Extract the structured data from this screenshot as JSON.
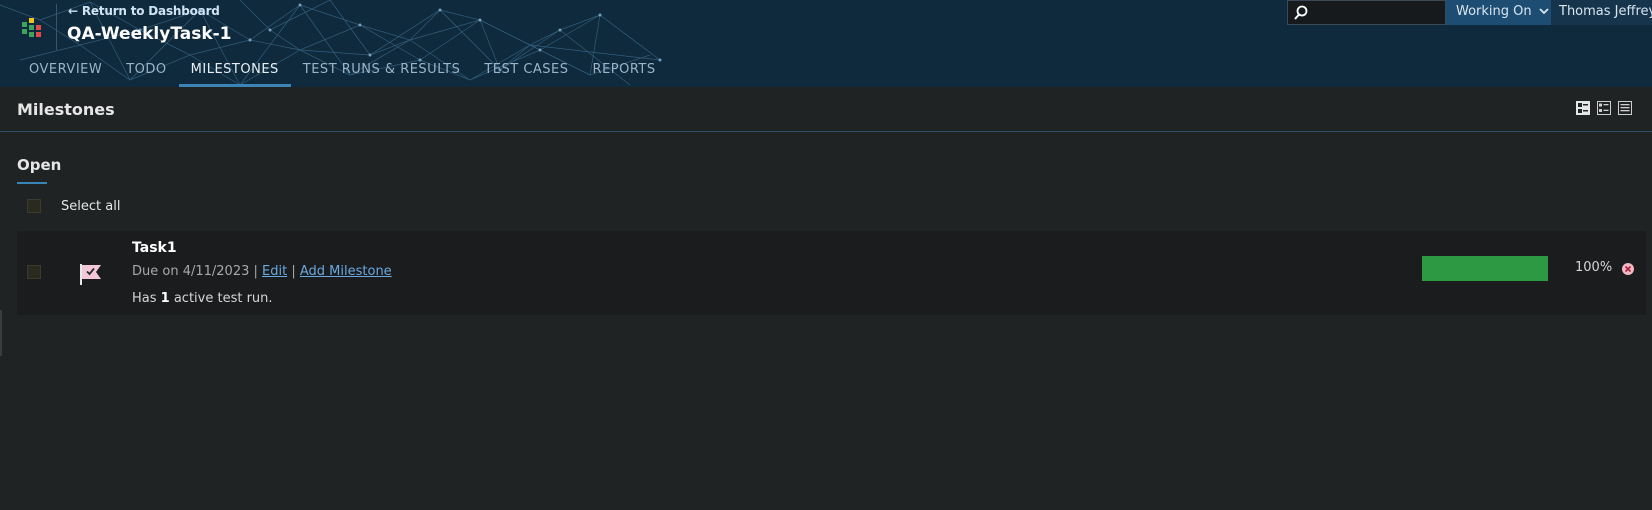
{
  "header": {
    "back_link": "← Return to Dashboard",
    "project_title": "QA-WeeklyTask-1",
    "tabs": [
      {
        "label": "OVERVIEW",
        "active": false
      },
      {
        "label": "TODO",
        "active": false
      },
      {
        "label": "MILESTONES",
        "active": true
      },
      {
        "label": "TEST RUNS & RESULTS",
        "active": false
      },
      {
        "label": "TEST CASES",
        "active": false
      },
      {
        "label": "REPORTS",
        "active": false
      }
    ],
    "search": {
      "placeholder": "",
      "value": ""
    },
    "working_on_label": "Working On",
    "user_name": "Thomas Jeffrey"
  },
  "page": {
    "title": "Milestones",
    "view_icons": [
      "compact-view-icon",
      "detailed-view-icon",
      "list-view-icon"
    ]
  },
  "section": {
    "title": "Open",
    "select_all_label": "Select all"
  },
  "milestones": [
    {
      "name": "Task1",
      "due_prefix": "Due on 4/11/2023 |",
      "edit_label": "Edit",
      "separator": "|",
      "add_label": "Add Milestone",
      "desc_prefix": "Has",
      "active_count": "1",
      "desc_suffix": "active test run.",
      "progress_fraction": 1.0,
      "progress_text": "100%"
    }
  ],
  "colors": {
    "header_bg": "#0f2a3d",
    "accent": "#3b84b8",
    "progress": "#2e9943",
    "link": "#6aa9e0"
  }
}
